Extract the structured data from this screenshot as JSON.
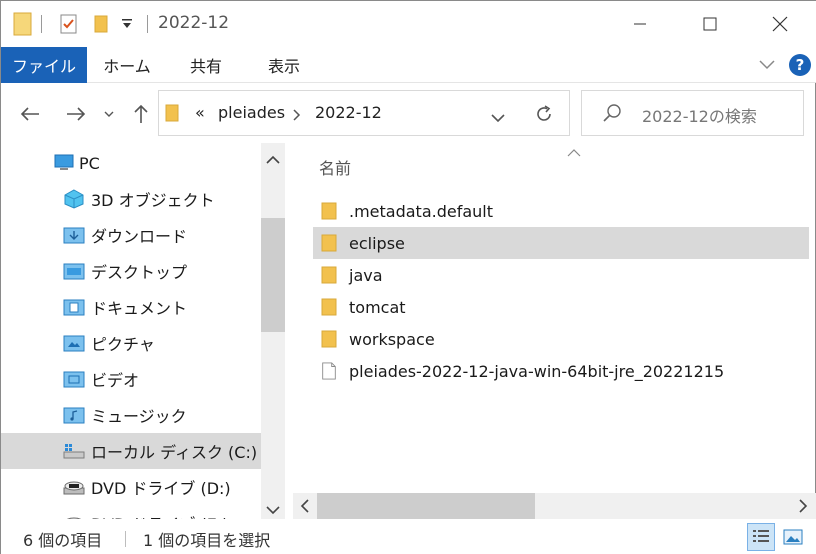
{
  "titlebar": {
    "title": "2022-12",
    "minimize_label": "—",
    "maximize_label": "☐",
    "close_label": "✕"
  },
  "ribbon": {
    "tabs": [
      {
        "label": "ファイル"
      },
      {
        "label": "ホーム"
      },
      {
        "label": "共有"
      },
      {
        "label": "表示"
      }
    ],
    "help_label": "?"
  },
  "address_bar": {
    "overflow_label": "«",
    "crumbs": [
      "pleiades",
      "2022-12"
    ]
  },
  "search": {
    "placeholder": "2022-12の検索"
  },
  "nav_pane": {
    "items": [
      {
        "label": "PC",
        "icon": "pc-icon"
      },
      {
        "label": "3D オブジェクト",
        "icon": "3d-objects-icon"
      },
      {
        "label": "ダウンロード",
        "icon": "downloads-icon"
      },
      {
        "label": "デスクトップ",
        "icon": "desktop-icon"
      },
      {
        "label": "ドキュメント",
        "icon": "documents-icon"
      },
      {
        "label": "ピクチャ",
        "icon": "pictures-icon"
      },
      {
        "label": "ビデオ",
        "icon": "videos-icon"
      },
      {
        "label": "ミュージック",
        "icon": "music-icon"
      },
      {
        "label": "ローカル ディスク (C:)",
        "icon": "local-disk-icon"
      },
      {
        "label": "DVD ドライブ (D:)",
        "icon": "dvd-drive-icon"
      },
      {
        "label": "DVD ドライブ (E:)",
        "icon": "dvd-drive-icon"
      }
    ]
  },
  "content": {
    "column_header": "名前",
    "files": [
      {
        "name": ".metadata.default",
        "type": "folder"
      },
      {
        "name": "eclipse",
        "type": "folder"
      },
      {
        "name": "java",
        "type": "folder"
      },
      {
        "name": "tomcat",
        "type": "folder"
      },
      {
        "name": "workspace",
        "type": "folder"
      },
      {
        "name": "pleiades-2022-12-java-win-64bit-jre_20221215",
        "type": "file"
      }
    ]
  },
  "status": {
    "item_count": "6 個の項目",
    "selection": "1 個の項目を選択"
  },
  "colors": {
    "accent": "#1a62b7",
    "folder": "#f2c14e",
    "selection": "#d9d9d9"
  }
}
